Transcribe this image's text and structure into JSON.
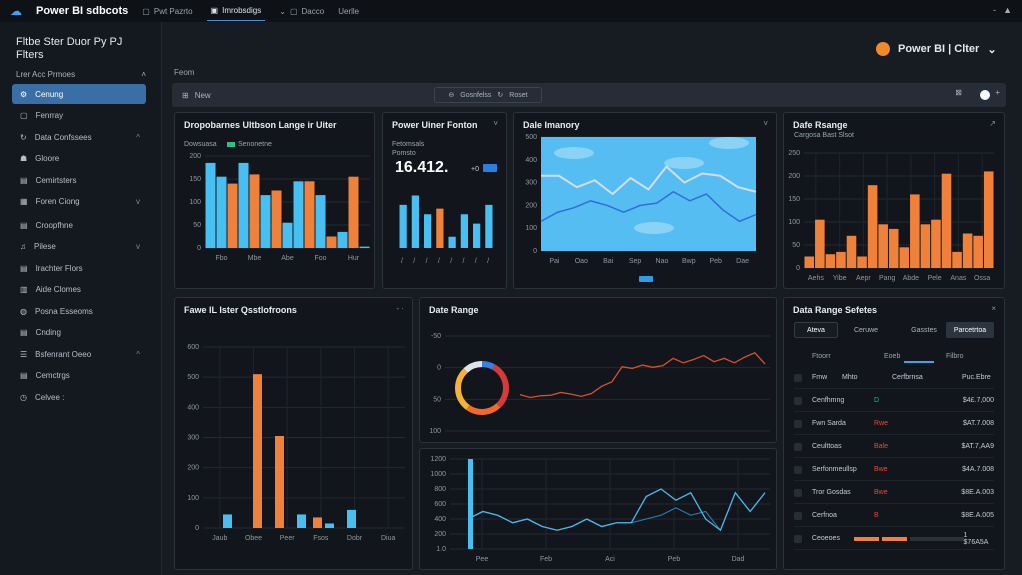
{
  "topbar": {
    "app_title": "Power BI sdbcots",
    "tabs": [
      "Pwt Pazrto",
      "Imrobsdigs",
      "Dacco",
      "Uerlle"
    ],
    "window_controls": [
      "-",
      "▲"
    ]
  },
  "sidebar": {
    "title": "Fltbe Ster Duor Py PJ Flters",
    "section": "Lrer Acc Prmoes",
    "items": [
      {
        "label": "Cenung",
        "icon": "gear-icon",
        "active": true
      },
      {
        "label": "Fenrray",
        "icon": "folder-icon"
      },
      {
        "label": "Data Confssees",
        "icon": "refresh-icon",
        "chevron": "^"
      },
      {
        "label": "Gloore",
        "icon": "users-icon"
      },
      {
        "label": "Cemirtsters",
        "icon": "doc-icon"
      },
      {
        "label": "Foren Ciong",
        "icon": "calendar-icon",
        "chevron": "v"
      },
      {
        "label": "Croopfhne",
        "icon": "doc-icon"
      },
      {
        "label": "Pilese",
        "icon": "bell-icon",
        "chevron": "v"
      },
      {
        "label": "Irachter Flors",
        "icon": "doc-icon"
      },
      {
        "label": "Aide Clomes",
        "icon": "grid-icon"
      },
      {
        "label": "Posna Esseoms",
        "icon": "globe-icon"
      },
      {
        "label": "Cnding",
        "icon": "doc-icon"
      },
      {
        "label": "Bsfenrant Oeeo",
        "icon": "list-icon",
        "chevron": "^"
      },
      {
        "label": "Cemctrgs",
        "icon": "doc-icon"
      },
      {
        "label": "Celvee :",
        "icon": "clock-icon"
      }
    ]
  },
  "main": {
    "label": "Feom",
    "brand": "Power BI | Clter",
    "filterbar": {
      "left": "New",
      "pill_a": "Gosnfelss",
      "pill_b": "Roset"
    }
  },
  "accent": "#3aa0ff",
  "orange": "#f0813a",
  "blue": "#47bff0",
  "chart_data": [
    {
      "id": "c1",
      "type": "bar",
      "title": "Dropobarnes Ultbson Lange ir Uiter",
      "legend": [
        "Dowsuasa",
        "Senonetne"
      ],
      "yticks": [
        "0",
        "50",
        "100",
        "150",
        "200"
      ],
      "ylim": [
        0,
        200
      ],
      "xticks": [
        "Fbo",
        "Mbe",
        "Abe",
        "Foo",
        "Hur"
      ],
      "bars": [
        [
          "b",
          185
        ],
        [
          "b",
          155
        ],
        [
          "o",
          140
        ],
        [
          "b",
          185
        ],
        [
          "o",
          160
        ],
        [
          "b",
          115
        ],
        [
          "o",
          125
        ],
        [
          "b",
          55
        ],
        [
          "b",
          145
        ],
        [
          "o",
          145
        ],
        [
          "b",
          115
        ],
        [
          "o",
          25
        ],
        [
          "b",
          35
        ],
        [
          "o",
          155
        ],
        [
          "b",
          3
        ]
      ]
    },
    {
      "id": "c2",
      "type": "bar",
      "title": "Power Uiner Fonton",
      "sub1": "Fetomsals",
      "sub2": "Pomsto",
      "kpi": "16.412.",
      "kpi_badge": "+0",
      "ylim": [
        0,
        160
      ],
      "bars": [
        [
          "b",
          115
        ],
        [
          "b",
          140
        ],
        [
          "b",
          90
        ],
        [
          "o",
          105
        ],
        [
          "b",
          30
        ],
        [
          "b",
          90
        ],
        [
          "b",
          65
        ],
        [
          "b",
          115
        ]
      ],
      "xticks": [
        "/",
        "/",
        "/",
        "/",
        "/",
        "/",
        "/",
        "/"
      ]
    },
    {
      "id": "c3",
      "type": "line",
      "title": "Dale Imanory",
      "ylim": [
        0,
        500
      ],
      "yticks": [
        "0",
        "100",
        "200",
        "300",
        "400",
        "500"
      ],
      "xticks": [
        "Pai",
        "Oao",
        "Bai",
        "Sep",
        "Nao",
        "Bwp",
        "Peb",
        "Dae"
      ],
      "series": [
        {
          "values": [
            330,
            330,
            280,
            310,
            250,
            320,
            270,
            370,
            300,
            340,
            330,
            280,
            260
          ]
        },
        {
          "values": [
            130,
            170,
            190,
            220,
            200,
            170,
            200,
            210,
            260,
            220,
            250,
            180,
            130,
            160
          ]
        }
      ]
    },
    {
      "id": "c4",
      "type": "bar",
      "title": "Dafe Rsange",
      "sub": "Cargosa Bast Slsot",
      "ylim": [
        0,
        250
      ],
      "yticks": [
        "0",
        "50",
        "100",
        "150",
        "200",
        "250"
      ],
      "xticks": [
        "Aehs",
        "Yibe",
        "Aepr",
        "Pang",
        "Abde",
        "Pele",
        "Anas",
        "Ossa"
      ],
      "bars": [
        [
          "o",
          25
        ],
        [
          "o",
          105
        ],
        [
          "o",
          30
        ],
        [
          "o",
          35
        ],
        [
          "o",
          70
        ],
        [
          "o",
          25
        ],
        [
          "o",
          180
        ],
        [
          "o",
          95
        ],
        [
          "o",
          85
        ],
        [
          "o",
          45
        ],
        [
          "o",
          160
        ],
        [
          "o",
          95
        ],
        [
          "o",
          105
        ],
        [
          "o",
          205
        ],
        [
          "o",
          35
        ],
        [
          "o",
          75
        ],
        [
          "o",
          70
        ],
        [
          "o",
          210
        ]
      ]
    },
    {
      "id": "c5",
      "type": "bar",
      "title": "Fawe IL Ister Qsstlofroons",
      "ylim": [
        0,
        600
      ],
      "yticks": [
        "0",
        "100",
        "200",
        "300",
        "400",
        "500",
        "600"
      ],
      "xticks": [
        "Jaub",
        "Obee",
        "Peer",
        "Fsos",
        "Dobr",
        "Diua"
      ],
      "bars": [
        [
          "b",
          45
        ],
        [
          "o",
          510
        ],
        [
          "o",
          305
        ],
        [
          "b",
          45
        ],
        [
          "o",
          35
        ],
        [
          "b",
          15
        ],
        [
          "b",
          60
        ]
      ]
    },
    {
      "id": "c6",
      "type": "line",
      "title": "Date Range",
      "yticks": [
        "100",
        "50",
        "0",
        "-50"
      ],
      "ylim": [
        -60,
        110
      ],
      "donut": [
        {
          "value": 8,
          "color": "#3a7ee0"
        },
        {
          "value": 30,
          "color": "#d63a3a"
        },
        {
          "value": 22,
          "color": "#f06a2a"
        },
        {
          "value": 28,
          "color": "#f5b23a"
        },
        {
          "value": 12,
          "color": "#dfe4ea"
        }
      ],
      "series": [
        {
          "values": [
            5,
            0,
            3,
            4,
            9,
            6,
            2,
            7,
            20,
            28,
            55,
            52,
            58,
            54,
            57,
            70,
            62,
            68,
            75,
            64,
            70,
            62,
            72,
            80,
            60
          ]
        }
      ]
    },
    {
      "id": "c7",
      "type": "line",
      "yticks": [
        "1.0",
        "200",
        "400",
        "600",
        "800",
        "1000",
        "1200"
      ],
      "ylim": [
        0,
        1200
      ],
      "xticks": [
        "Pee",
        "Feb",
        "Aci",
        "Peb",
        "Dad"
      ],
      "highlight": 1200,
      "series": [
        {
          "values": [
            400,
            500,
            450,
            350,
            400,
            300,
            250,
            300,
            400,
            300,
            350,
            350,
            700,
            800,
            650,
            750,
            400,
            250,
            750,
            500,
            750
          ]
        },
        {
          "values": [
            400,
            500,
            450,
            350,
            400,
            300,
            250,
            300,
            400,
            300,
            350,
            350,
            400,
            450,
            550,
            450,
            500,
            250,
            750,
            500,
            750
          ]
        }
      ]
    }
  ],
  "selector": {
    "title": "Data Range Sefetes",
    "segments": [
      "Ateva",
      "Ceruwe",
      "Gasstes",
      "Parcetrtoa"
    ],
    "subtabs": [
      "Ftoorr",
      "Eoeb",
      "Filbro"
    ],
    "headers": [
      "Fmw",
      "Mhto",
      "Cerfbrnsa",
      "Puc.Ebre"
    ],
    "rows": [
      {
        "name": "Cenfhmng",
        "tag": "D",
        "tag_color": "#1fb4b4",
        "value": "$4£.7,000"
      },
      {
        "name": "Fwn Sarda",
        "tag": "Rwe",
        "tag_color": "#e24a3a",
        "value": "$AT.7.008"
      },
      {
        "name": "Ceulttoas",
        "tag": "Bale",
        "tag_color": "#e24a3a",
        "value": "$AT.7,AA9"
      },
      {
        "name": "Serfonmeullsp",
        "tag": "Bwe",
        "tag_color": "#e24a3a",
        "value": "$4A.7.008"
      },
      {
        "name": "Tror Gosdas",
        "tag": "Bwe",
        "tag_color": "#e24a3a",
        "value": "$8E.A.003"
      },
      {
        "name": "Cerfnoa",
        "tag": "B",
        "tag_color": "#e24a3a",
        "value": "$8E.A.005"
      },
      {
        "name": "Ceoeoes",
        "progress": [
          0.6,
          0.85
        ],
        "value": "1 $76A5A"
      }
    ]
  }
}
